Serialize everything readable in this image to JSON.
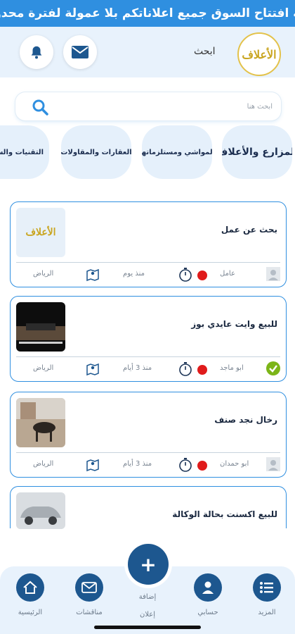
{
  "banner": {
    "text": "بة افتتاح السوق جميع اعلاناتكم بلا عمولة لفترة محدودة"
  },
  "header": {
    "search_label": "ابحث",
    "logo_text": "الأعلاف"
  },
  "search": {
    "placeholder": "ابحث هنا"
  },
  "categories": [
    {
      "label": "المزارع والأعلاف"
    },
    {
      "label": "المواشي ومستلزماتها"
    },
    {
      "label": "العقارات والمقاولات"
    },
    {
      "label": "التقنيات والسيا"
    }
  ],
  "listings": [
    {
      "title": "بحث عن عمل",
      "user": "عامل",
      "time": "منذ يوم",
      "city": "الرياض",
      "verified": false
    },
    {
      "title": "للبيع وايت عايدي بوز",
      "user": "ابو ماجد",
      "time": "منذ 3 أيام",
      "city": "الرياض",
      "verified": true
    },
    {
      "title": "رخال نجد صنف",
      "user": "ابو حمدان",
      "time": "منذ 3 أيام",
      "city": "الرياض",
      "verified": false
    },
    {
      "title": "للبيع اكسنت بحالة الوكالة",
      "user": "",
      "time": "",
      "city": "",
      "verified": false
    }
  ],
  "bottom_nav": {
    "more": "المزيد",
    "account": "حسابي",
    "add_line1": "إضافة",
    "add_line2": "إعلان",
    "tenders": "مناقشات",
    "home": "الرئيسية"
  },
  "colors": {
    "primary": "#2f8fe0",
    "dark": "#1d578f",
    "light_bg": "#e8f2fc",
    "status_red": "#e01b1b",
    "verified_green": "#7cb518"
  }
}
